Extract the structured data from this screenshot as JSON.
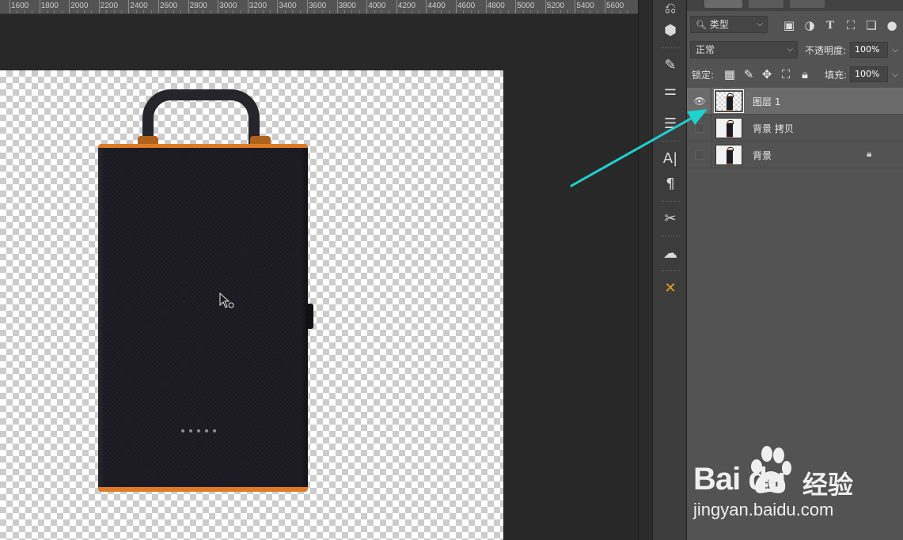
{
  "ruler": {
    "labels": [
      "1600",
      "1800",
      "2000",
      "2200",
      "2400",
      "2600",
      "2800",
      "3000",
      "3200",
      "3400",
      "3600",
      "3800",
      "4000",
      "4200",
      "4400",
      "4600",
      "4800",
      "5000",
      "5200",
      "5400",
      "5600"
    ]
  },
  "layers_panel": {
    "filter": {
      "value": "类型",
      "search_icon": "search-icon"
    },
    "blend_mode": "正常",
    "opacity_label": "不透明度:",
    "opacity_value": "100%",
    "lock_label": "锁定:",
    "fill_label": "填充:",
    "fill_value": "100%",
    "layers": [
      {
        "name": "图层 1",
        "visible": true,
        "active": true,
        "locked": false
      },
      {
        "name": "背景 拷贝",
        "visible": false,
        "active": false,
        "locked": false
      },
      {
        "name": "背景",
        "visible": false,
        "active": false,
        "locked": true
      }
    ]
  },
  "watermark": {
    "brand": "Bai du",
    "cn": "经验",
    "url": "jingyan.baidu.com"
  },
  "colors": {
    "accent_arrow": "#1fd1d0",
    "case_trim": "#e07b25"
  }
}
